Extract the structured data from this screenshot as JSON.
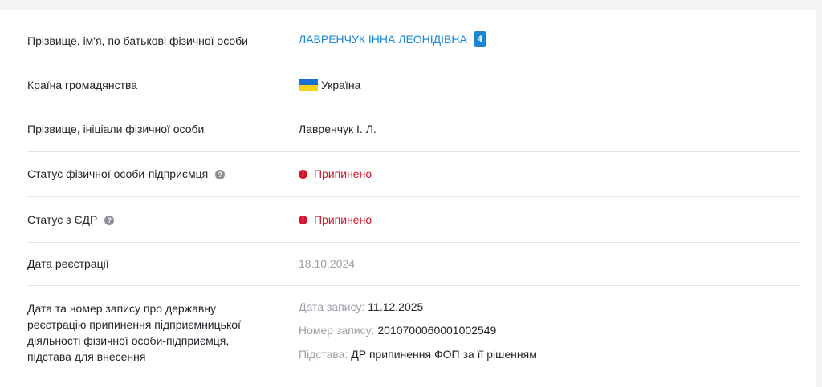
{
  "rows": [
    {
      "label": "Прізвище, ім'я, по батькові фізичної особи",
      "value": "ЛАВРЕНЧУК ІННА ЛЕОНІДІВНА",
      "badge": "4"
    },
    {
      "label": "Країна громадянства",
      "value": "Україна"
    },
    {
      "label": "Прізвище, ініціали фізичної особи",
      "value": "Лавренчук І. Л."
    },
    {
      "label": "Статус фізичної особи-підприємця",
      "value": "Припинено"
    },
    {
      "label": "Статус з ЄДР",
      "value": "Припинено"
    },
    {
      "label": "Дата реєстрації",
      "value": "18.10.2024"
    }
  ],
  "termination": {
    "label_lines": [
      "Дата та номер запису про державну",
      "реєстрацію припинення підприємницької",
      "діяльності фізичної особи-підприємця,",
      "підстава для внесення"
    ],
    "record_date_label": "Дата запису:",
    "record_date": "11.12.2025",
    "record_number_label": "Номер запису:",
    "record_number": "2010700060001002549",
    "basis_label": "Підстава:",
    "basis": "ДР припинення ФОП за її рішенням"
  },
  "colors": {
    "link": "#1a86d6",
    "status_terminated": "#d3132a",
    "muted": "#9aa0a6"
  },
  "icons": {
    "help": "question-circle-icon",
    "status": "exclamation-circle-icon",
    "flag": "ukraine-flag-icon"
  }
}
